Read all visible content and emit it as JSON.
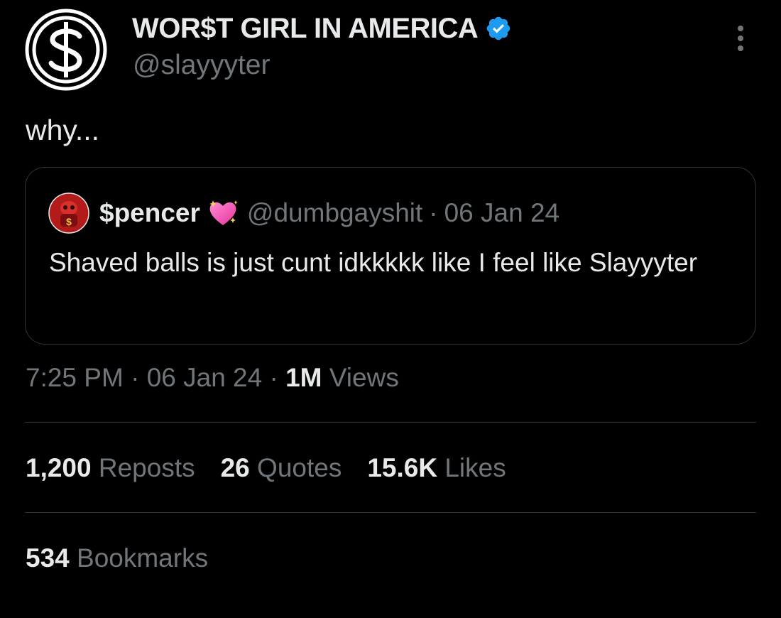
{
  "author": {
    "name": "WOR$T GIRL IN AMERICA",
    "handle": "@slayyyter",
    "avatar_icon": "dollar-sign-circle-icon",
    "verified_icon": "verified-badge-icon",
    "verified_color": "#1d9bf0"
  },
  "tweet": {
    "text": "why..."
  },
  "quote": {
    "author_name": "$pencer",
    "emoji": "sparkling-heart-icon",
    "handle": "@dumbgayshit",
    "separator": "·",
    "date": "06 Jan 24",
    "text": "Shaved balls is just cunt idkkkkk like I feel like Slayyyter"
  },
  "meta": {
    "time": "7:25 PM",
    "separator": "·",
    "date": "06 Jan 24",
    "views_count": "1M",
    "views_label": "Views"
  },
  "stats": {
    "reposts_count": "1,200",
    "reposts_label": "Reposts",
    "quotes_count": "26",
    "quotes_label": "Quotes",
    "likes_count": "15.6K",
    "likes_label": "Likes",
    "bookmarks_count": "534",
    "bookmarks_label": "Bookmarks"
  },
  "colors": {
    "background": "#000000",
    "primary_text": "#e7e9ea",
    "secondary_text": "#71767b",
    "border": "#2f3336"
  }
}
